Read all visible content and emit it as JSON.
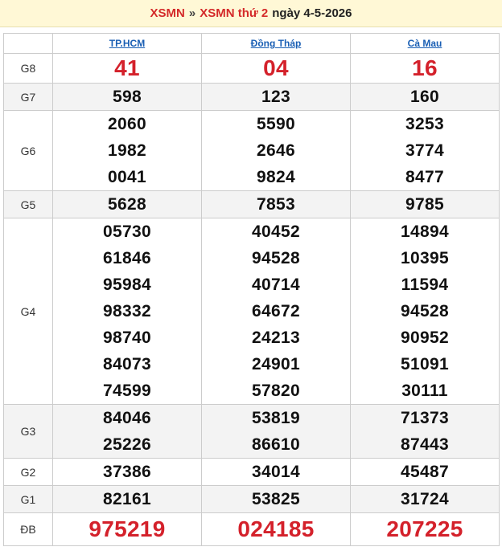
{
  "header": {
    "link1": "XSMN",
    "separator": "»",
    "link2": "XSMN thứ 2",
    "date_text": "ngày 4-5-2026"
  },
  "provinces": [
    "TP.HCM",
    "Đồng Tháp",
    "Cà Mau"
  ],
  "prizes": [
    {
      "label": "G8",
      "values": [
        [
          "41"
        ],
        [
          "04"
        ],
        [
          "16"
        ]
      ]
    },
    {
      "label": "G7",
      "values": [
        [
          "598"
        ],
        [
          "123"
        ],
        [
          "160"
        ]
      ]
    },
    {
      "label": "G6",
      "values": [
        [
          "2060",
          "1982",
          "0041"
        ],
        [
          "5590",
          "2646",
          "9824"
        ],
        [
          "3253",
          "3774",
          "8477"
        ]
      ]
    },
    {
      "label": "G5",
      "values": [
        [
          "5628"
        ],
        [
          "7853"
        ],
        [
          "9785"
        ]
      ]
    },
    {
      "label": "G4",
      "values": [
        [
          "05730",
          "61846",
          "95984",
          "98332",
          "98740",
          "84073",
          "74599"
        ],
        [
          "40452",
          "94528",
          "40714",
          "64672",
          "24213",
          "24901",
          "57820"
        ],
        [
          "14894",
          "10395",
          "11594",
          "94528",
          "90952",
          "51091",
          "30111"
        ]
      ]
    },
    {
      "label": "G3",
      "values": [
        [
          "84046",
          "25226"
        ],
        [
          "53819",
          "86610"
        ],
        [
          "71373",
          "87443"
        ]
      ]
    },
    {
      "label": "G2",
      "values": [
        [
          "37386"
        ],
        [
          "34014"
        ],
        [
          "45487"
        ]
      ]
    },
    {
      "label": "G1",
      "values": [
        [
          "82161"
        ],
        [
          "53825"
        ],
        [
          "31724"
        ]
      ]
    },
    {
      "label": "ĐB",
      "values": [
        [
          "975219"
        ],
        [
          "024185"
        ],
        [
          "207225"
        ]
      ]
    }
  ],
  "colors": {
    "accent_red": "#d4212b",
    "link_blue": "#1a5fb4",
    "header_bg": "#fff8d6"
  }
}
